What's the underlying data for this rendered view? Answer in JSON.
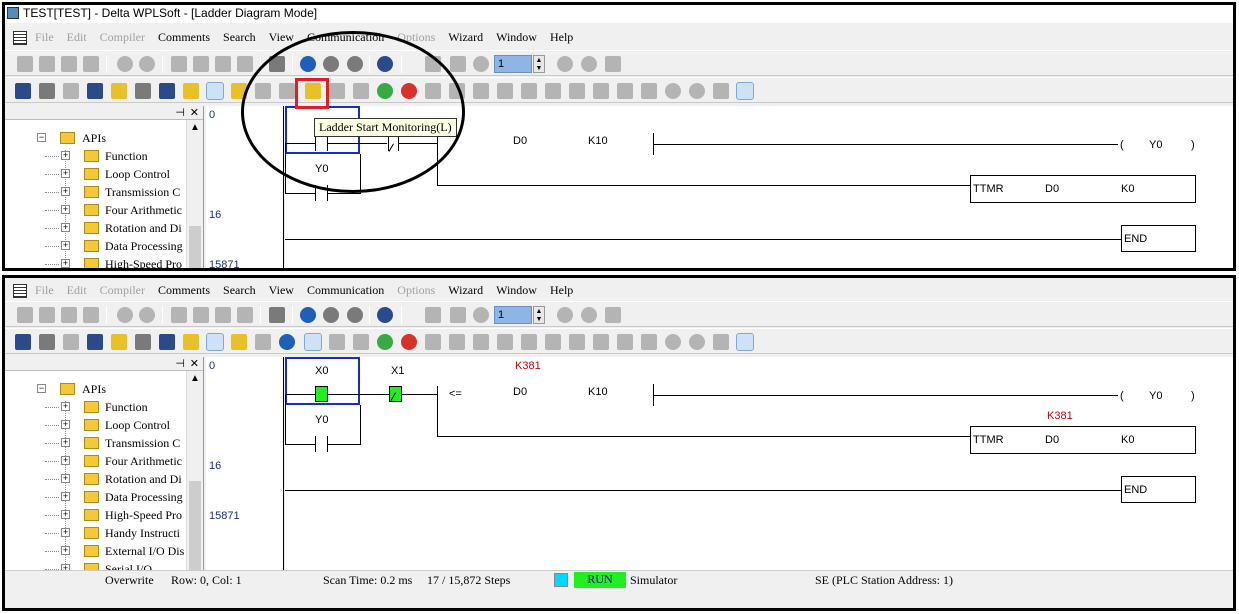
{
  "window": {
    "title": "TEST[TEST] - Delta WPLSoft - [Ladder Diagram Mode]"
  },
  "menu": [
    {
      "label": "File",
      "enabled": false
    },
    {
      "label": "Edit",
      "enabled": false
    },
    {
      "label": "Compiler",
      "enabled": false
    },
    {
      "label": "Comments",
      "enabled": true
    },
    {
      "label": "Search",
      "enabled": true
    },
    {
      "label": "View",
      "enabled": true
    },
    {
      "label": "Communication",
      "enabled": true
    },
    {
      "label": "Options",
      "enabled": false
    },
    {
      "label": "Wizard",
      "enabled": true
    },
    {
      "label": "Window",
      "enabled": true
    },
    {
      "label": "Help",
      "enabled": true
    }
  ],
  "toolbar": {
    "station_value": "1"
  },
  "tooltip": {
    "text": "Ladder Start Monitoring(L)"
  },
  "tree": {
    "root": "APIs",
    "items_top": [
      "Function",
      "Loop Control",
      "Transmission C",
      "Four Arithmetic",
      "Rotation and Di",
      "Data Processing",
      "High-Speed Pro"
    ],
    "items_bottom": [
      "Function",
      "Loop Control",
      "Transmission C",
      "Four Arithmetic",
      "Rotation and Di",
      "Data Processing",
      "High-Speed Pro",
      "Handy Instructi",
      "External I/O Dis",
      "Serial I/O"
    ]
  },
  "gutter": {
    "line1": "0",
    "line2": "16",
    "line3": "15871"
  },
  "ladder": {
    "contact1": "X0",
    "contact2": "X1",
    "parallel": "Y0",
    "compare_op": "<=",
    "cmp_src": "D0",
    "cmp_val": "K10",
    "monitor_value": "K381",
    "coil_open": "(",
    "coil": "Y0",
    "coil_close": ")",
    "tmr_cmd": "TTMR",
    "tmr_dev": "D0",
    "tmr_val": "K0",
    "end": "END"
  },
  "status": {
    "mode": "Overwrite",
    "position": "Row: 0, Col: 1",
    "scan": "Scan Time: 0.2 ms",
    "steps": "17 / 15,872 Steps",
    "run": "RUN",
    "simulator": "Simulator",
    "station": "SE (PLC Station Address: 1)"
  },
  "colors": {
    "run_green": "#22ee22",
    "monitor_red": "#c80000",
    "selection_blue": "#1a2cc8"
  }
}
